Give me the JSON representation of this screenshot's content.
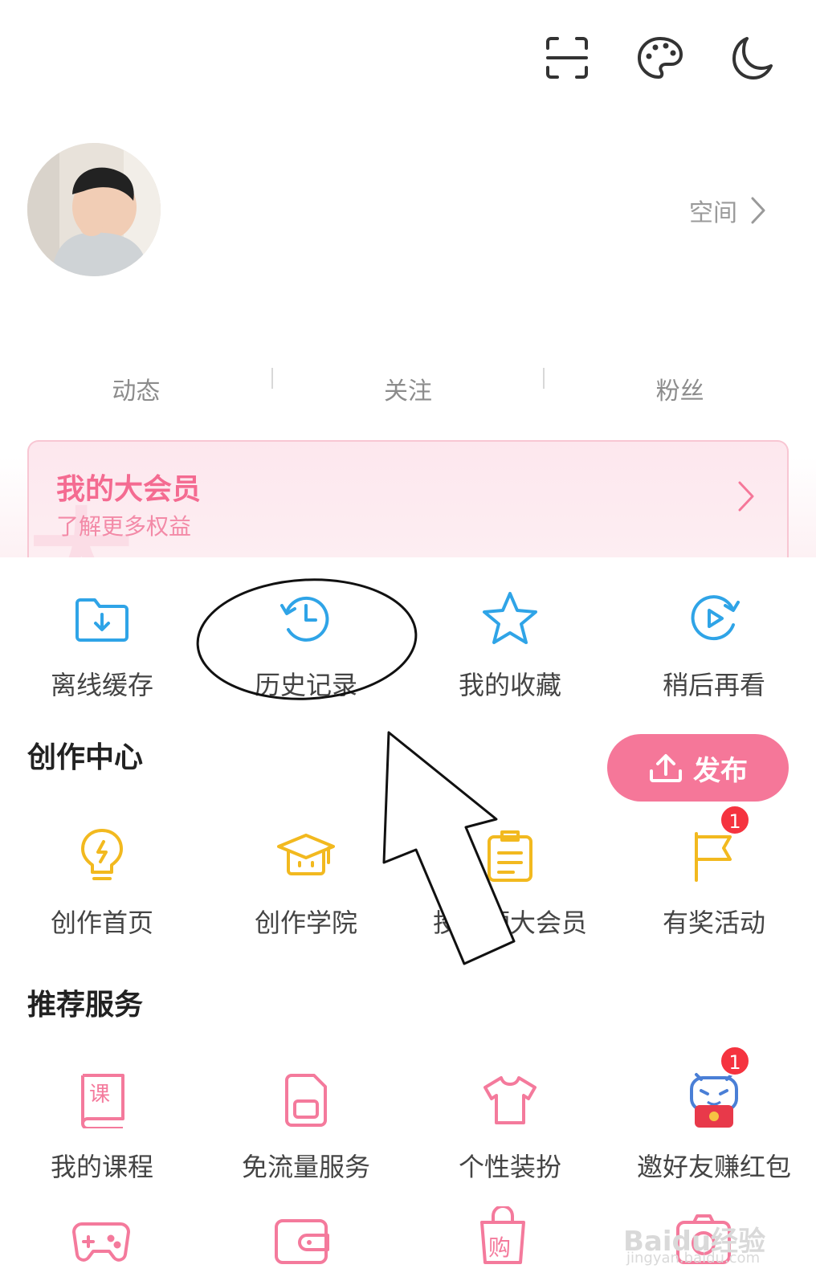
{
  "header": {
    "icons": [
      "scan-icon",
      "palette-icon",
      "moon-icon"
    ],
    "space_label": "空间"
  },
  "stats": [
    {
      "label": "动态"
    },
    {
      "label": "关注"
    },
    {
      "label": "粉丝"
    }
  ],
  "vip": {
    "title": "我的大会员",
    "subtitle": "了解更多权益",
    "watermark": "大"
  },
  "quick_actions": [
    {
      "label": "离线缓存",
      "icon": "offline-cache-icon"
    },
    {
      "label": "历史记录",
      "icon": "history-icon"
    },
    {
      "label": "我的收藏",
      "icon": "favorite-star-icon"
    },
    {
      "label": "稍后再看",
      "icon": "watch-later-icon"
    }
  ],
  "creation": {
    "title": "创作中心",
    "publish_label": "发布",
    "items": [
      {
        "label": "创作首页",
        "icon": "lightbulb-icon"
      },
      {
        "label": "创作学院",
        "icon": "academy-cap-icon"
      },
      {
        "label": "投稿领大会员",
        "icon": "clipboard-icon"
      },
      {
        "label": "有奖活动",
        "icon": "flag-icon",
        "badge": "1"
      }
    ]
  },
  "services": {
    "title": "推荐服务",
    "items": [
      {
        "label": "我的课程",
        "icon": "course-book-icon",
        "glyph": "课"
      },
      {
        "label": "免流量服务",
        "icon": "sim-card-icon"
      },
      {
        "label": "个性装扮",
        "icon": "tshirt-icon"
      },
      {
        "label": "邀好友赚红包",
        "icon": "mascot-redpacket-icon",
        "badge": "1"
      }
    ],
    "more_icons": [
      "gamepad-icon",
      "wallet-icon",
      "shopping-bag-icon",
      "camera-icon"
    ],
    "more_glyph": "购"
  },
  "watermark": {
    "brand": "Baidu经验",
    "url": "jingyan.baidu.com"
  },
  "colors": {
    "accent_pink": "#f57799",
    "blue_icon": "#2fa4e7",
    "yellow_icon": "#f2b91f",
    "pink_icon": "#f47a9c",
    "badge_red": "#f5333f"
  }
}
